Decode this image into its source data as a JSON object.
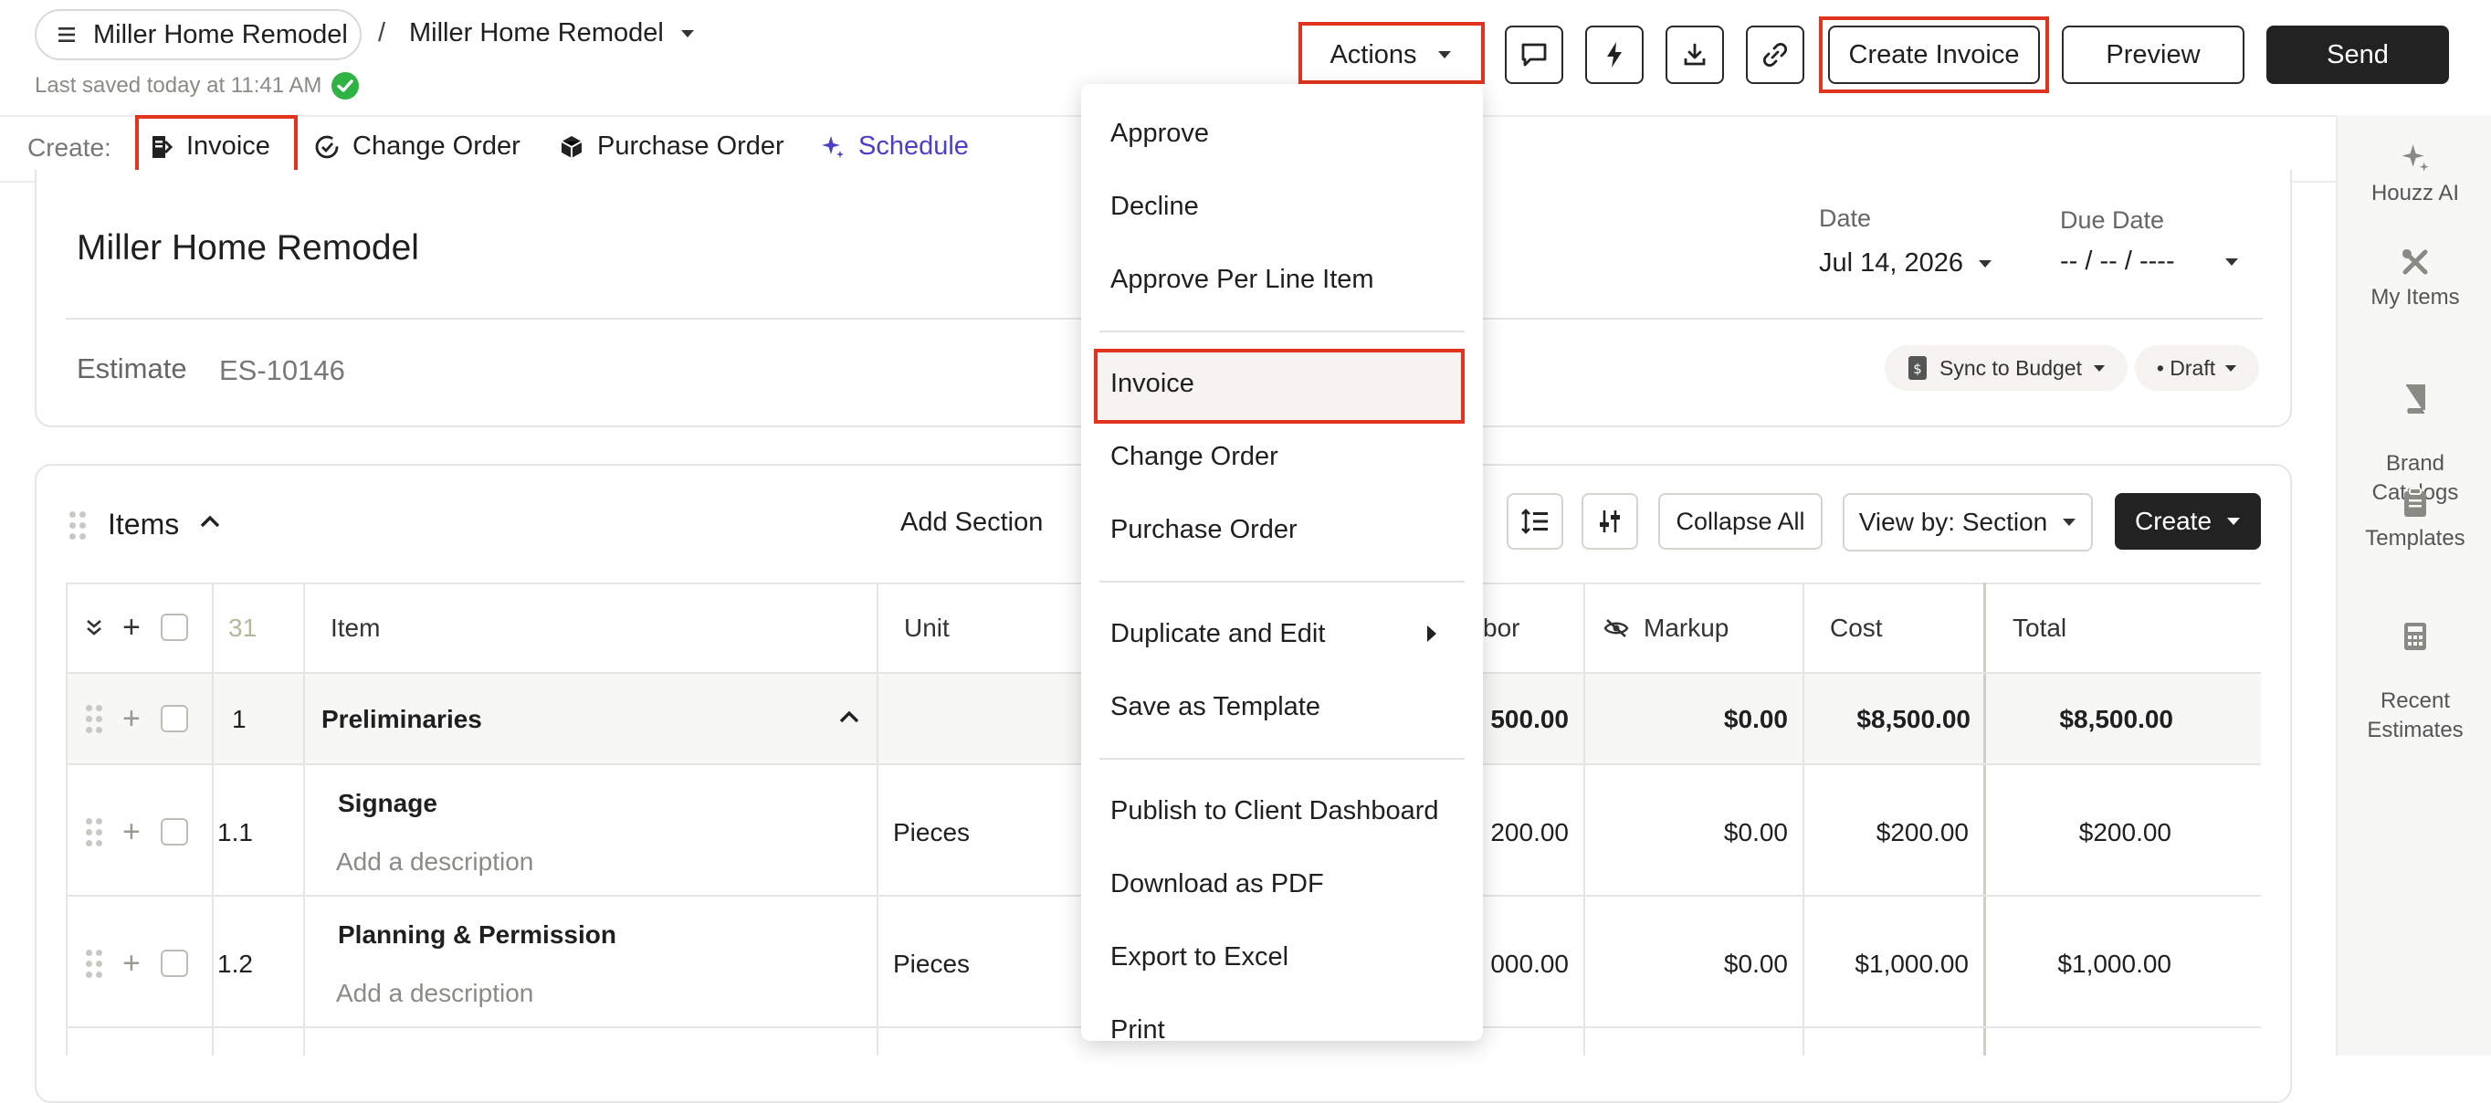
{
  "header": {
    "project_label": "Miller Home Remodel",
    "separator": "/",
    "doc_title": "Miller Home Remodel",
    "last_saved": "Last saved today at 11:41 AM",
    "actions_label": "Actions",
    "create_invoice_label": "Create Invoice",
    "preview_label": "Preview",
    "send_label": "Send"
  },
  "create_bar": {
    "label": "Create:",
    "items": [
      "Invoice",
      "Change Order",
      "Purchase Order",
      "Schedule"
    ]
  },
  "doc": {
    "title": "Miller Home Remodel",
    "date_label": "Date",
    "date_value": "Jul 14, 2026",
    "due_label": "Due Date",
    "due_value": "-- / -- / ----",
    "estimate_label": "Estimate",
    "estimate_number": "ES-10146",
    "sync_label": "Sync to Budget",
    "status_label": "• Draft"
  },
  "items_section": {
    "title": "Items",
    "add_section": "Add Section",
    "collapse_all": "Collapse All",
    "view_by": "View by: Section",
    "create": "Create"
  },
  "table": {
    "count": "31",
    "columns": {
      "item": "Item",
      "unit": "Unit",
      "labor": "bor",
      "markup": "Markup",
      "cost": "Cost",
      "total": "Total"
    },
    "rows": [
      {
        "num": "1",
        "name": "Preliminaries",
        "desc": "",
        "unit": "",
        "labor": "500.00",
        "markup": "$0.00",
        "cost": "$8,500.00",
        "total": "$8,500.00"
      },
      {
        "num": "1.1",
        "name": "Signage",
        "desc": "Add a description",
        "unit": "Pieces",
        "labor": "200.00",
        "markup": "$0.00",
        "cost": "$200.00",
        "total": "$200.00"
      },
      {
        "num": "1.2",
        "name": "Planning & Permission",
        "desc": "Add a description",
        "unit": "Pieces",
        "labor": "000.00",
        "markup": "$0.00",
        "cost": "$1,000.00",
        "total": "$1,000.00"
      }
    ]
  },
  "actions_menu": {
    "items": [
      "Approve",
      "Decline",
      "Approve Per Line Item",
      "Invoice",
      "Change Order",
      "Purchase Order",
      "Duplicate and Edit",
      "Save as Template",
      "Publish to Client Dashboard",
      "Download as PDF",
      "Export to Excel",
      "Print"
    ]
  },
  "sidebar": {
    "items": [
      "Houzz AI",
      "My Items",
      "Brand\nCatalogs",
      "Templates",
      "Recent\nEstimates"
    ]
  },
  "colors": {
    "highlight": "#e0341f",
    "accent": "#4b3fc7",
    "dark": "#222222",
    "saved_check": "#2fb344"
  }
}
